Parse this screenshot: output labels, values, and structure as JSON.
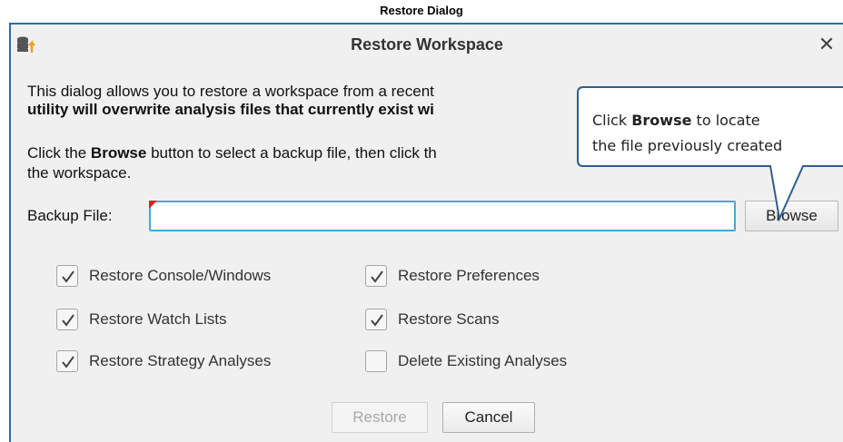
{
  "caption": "Restore Dialog",
  "dialog": {
    "title": "Restore Workspace",
    "app_icon": "database-restore-icon",
    "close_icon": "close-icon",
    "close_glyph": "✕",
    "description": {
      "line1": "This dialog allows you to restore a workspace from a recent",
      "line2_bold": "utility will overwrite analysis files that currently exist wi"
    },
    "instruction": {
      "part1": "Click the ",
      "bold": "Browse",
      "part2": " button to select a backup file, then click th",
      "line2": "the workspace."
    },
    "backup_file_label": "Backup File:",
    "backup_file_value": "",
    "browse_label": "Browse",
    "checkboxes": [
      {
        "label": "Restore Console/Windows",
        "checked": true
      },
      {
        "label": "Restore Preferences",
        "checked": true
      },
      {
        "label": "Restore Watch Lists",
        "checked": true
      },
      {
        "label": "Restore Scans",
        "checked": true
      },
      {
        "label": "Restore Strategy Analyses",
        "checked": true
      },
      {
        "label": "Delete Existing Analyses",
        "checked": false
      }
    ],
    "restore_label": "Restore",
    "restore_enabled": false,
    "cancel_label": "Cancel"
  },
  "callout": {
    "prefix": "Click ",
    "bold": "Browse",
    "suffix": " to locate",
    "line2": "the file previously created",
    "border_color": "#2e5e8c"
  },
  "colors": {
    "dialog_border": "#2b6cb5",
    "input_focus": "#48a7d9",
    "required_marker": "#e02020"
  }
}
